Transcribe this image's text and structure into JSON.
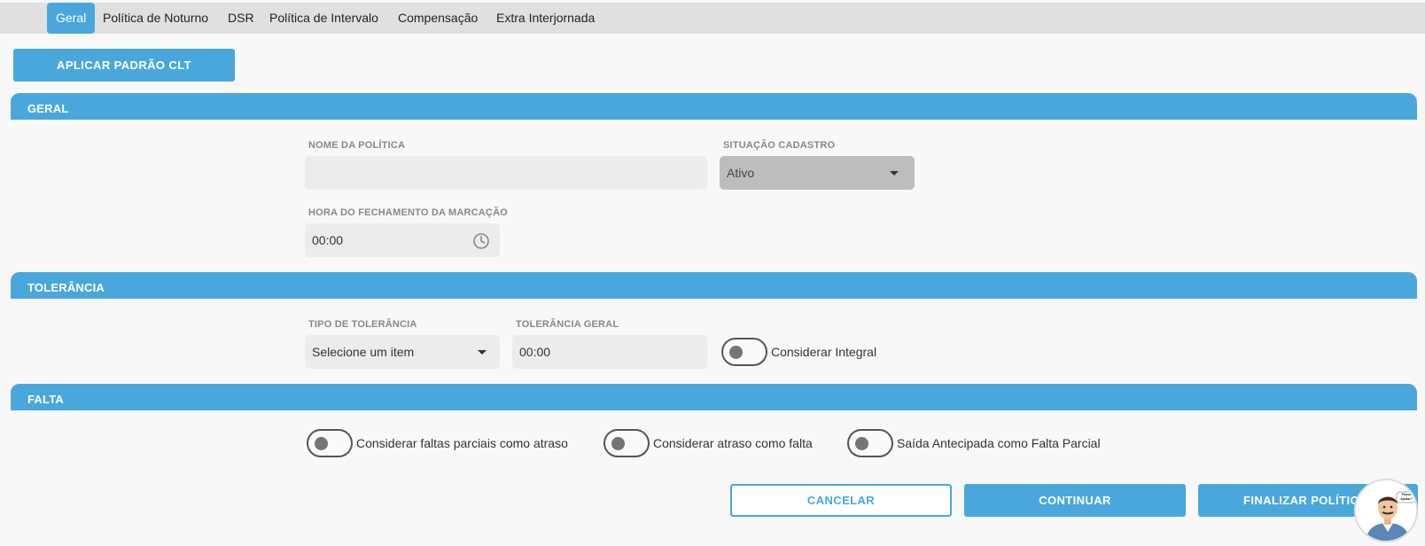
{
  "tabs": [
    {
      "label": "Geral",
      "active": true
    },
    {
      "label": "Política de Noturno",
      "active": false
    },
    {
      "label": "DSR",
      "active": false
    },
    {
      "label": "Política de Intervalo",
      "active": false
    },
    {
      "label": "Compensação",
      "active": false
    },
    {
      "label": "Extra Interjornada",
      "active": false
    }
  ],
  "apply_clt_button": "APLICAR PADRÃO CLT",
  "sections": {
    "geral": {
      "title": "GERAL",
      "policy_name_label": "NOME DA POLÍTICA",
      "policy_name_value": "",
      "status_label": "SITUAÇÃO CADASTRO",
      "status_value": "Ativo",
      "closing_hour_label": "HORA DO FECHAMENTO DA MARCAÇÃO",
      "closing_hour_value": "00:00"
    },
    "tolerancia": {
      "title": "TOLERÂNCIA",
      "type_label": "TIPO DE TOLERÂNCIA",
      "type_value": "Selecione um item",
      "general_label": "TOLERÂNCIA GERAL",
      "general_value": "00:00",
      "integral_toggle": {
        "label": "Considerar Integral",
        "on": false
      }
    },
    "falta": {
      "title": "FALTA",
      "toggles": [
        {
          "label": "Considerar faltas parciais como atraso",
          "on": false
        },
        {
          "label": "Considerar atraso como falta",
          "on": false
        },
        {
          "label": "Saída Antecipada como Falta Parcial",
          "on": false
        }
      ]
    }
  },
  "actions": {
    "cancel": "CANCELAR",
    "continue": "CONTINUAR",
    "finish": "FINALIZAR POLÍTIC"
  },
  "assistant": {
    "bubble_text": "Posso Ajudar?"
  },
  "icons": {
    "clock": "clock-icon",
    "dropdown": "chevron-down-icon"
  },
  "colors": {
    "accent": "#4aa7db",
    "tabbar": "#e0e0e0",
    "field": "#ececec",
    "status_field": "#bdbdbd"
  }
}
